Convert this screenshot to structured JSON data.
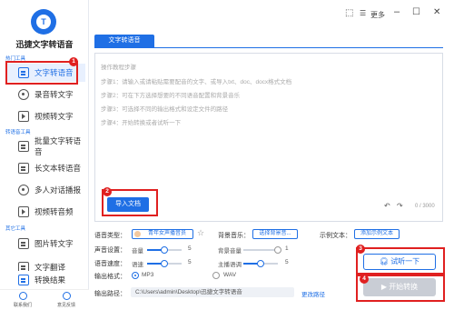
{
  "app": {
    "logo_text": "T",
    "title": "迅捷文字转语音"
  },
  "topbar": {
    "more_label": "更多"
  },
  "sidebar": {
    "section_common": "热门工具",
    "section_convert": "转语音工具",
    "section_other": "其它工具",
    "items": [
      {
        "label": "文字转语音"
      },
      {
        "label": "录音转文字"
      },
      {
        "label": "视频转文字"
      },
      {
        "label": "批量文字转语音"
      },
      {
        "label": "长文本转语音"
      },
      {
        "label": "多人对话播报"
      },
      {
        "label": "视频转音频"
      },
      {
        "label": "图片转文字"
      },
      {
        "label": "文字翻译"
      }
    ],
    "bottom": {
      "results_label": "转换结果",
      "contact_label": "联系我们",
      "feedback_label": "意见反馈"
    }
  },
  "main": {
    "tab_label": "文字转语音",
    "editor": {
      "title": "操作教程步骤",
      "step1": "步骤1：请输入或请粘贴需要配音的文字、或导入txt、doc、docx格式文档",
      "step2": "步骤2：可在下方选择想要的不同语音配置和背景音乐",
      "step3": "步骤3：可选择不同的输出格式和设定文件的路径",
      "step4": "步骤4：开始转换或者试听一下",
      "counter": "0 / 3000"
    },
    "import_label": "导入文档",
    "settings": {
      "voice_type_label": "语音类型：",
      "voice_name": "青年女声播音员",
      "bg_music_label": "背景音乐：",
      "bg_music_button": "选择背景音...",
      "sample_label": "示例文本：",
      "sample_button": "添加示例文本",
      "sound_settings_label": "声音设置：",
      "volume_label": "音量",
      "volume_value": "5",
      "bg_volume_label": "背景音量",
      "bg_volume_value": "1",
      "voice_speed_label": "语音速度：",
      "speed_label": "语速",
      "speed_value": "5",
      "pitch_label": "主播语调",
      "pitch_value": "5",
      "output_format_label": "输出格式：",
      "format_mp3": "MP3",
      "format_wav": "WAV",
      "output_path_label": "输出路径：",
      "output_path_value": "C:\\Users\\admin\\Desktop\\迅捷文字转语音",
      "change_path_label": "更改路径"
    },
    "listen_label": "试听一下",
    "convert_label": "开始转换"
  },
  "badges": [
    "1",
    "2",
    "3",
    "4"
  ],
  "colors": {
    "accent": "#1f6fe5",
    "highlight": "#e02020",
    "disabled": "#c9cdd5"
  },
  "icons": [
    "logo-icon",
    "pin-icon",
    "more-icon",
    "minimize-icon",
    "maximize-icon",
    "close-icon",
    "document-icon",
    "microphone-icon",
    "video-icon",
    "undo-icon",
    "redo-icon",
    "star-icon",
    "headphone-icon",
    "play-icon"
  ]
}
